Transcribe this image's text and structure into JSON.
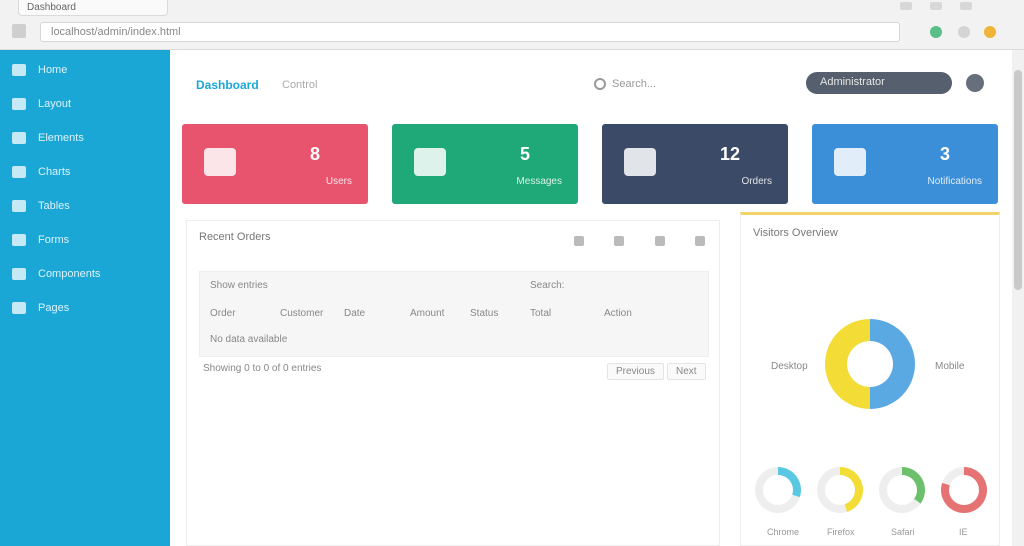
{
  "browser": {
    "tab_title": "Dashboard",
    "url": "localhost/admin/index.html"
  },
  "sidebar": {
    "items": [
      {
        "label": "Home",
        "icon": "home-icon"
      },
      {
        "label": "Layout",
        "icon": "layout-icon"
      },
      {
        "label": "Elements",
        "icon": "elements-icon"
      },
      {
        "label": "Charts",
        "icon": "chart-icon"
      },
      {
        "label": "Tables",
        "icon": "table-icon"
      },
      {
        "label": "Forms",
        "icon": "form-icon"
      },
      {
        "label": "Components",
        "icon": "components-icon"
      },
      {
        "label": "Pages",
        "icon": "pages-icon"
      }
    ]
  },
  "header": {
    "brand": "Dashboard",
    "brand_sub": "Control",
    "search_text": "Search...",
    "user_label": "Administrator"
  },
  "tiles": [
    {
      "value": "8",
      "label": "Users",
      "color": "#e8546d",
      "icon": "user-icon"
    },
    {
      "value": "5",
      "label": "Messages",
      "color": "#1fa878",
      "icon": "mail-icon"
    },
    {
      "value": "12",
      "label": "Orders",
      "color": "#3b4a66",
      "icon": "cart-icon"
    },
    {
      "value": "3",
      "label": "Notifications",
      "color": "#3a8fd8",
      "icon": "cloud-icon"
    }
  ],
  "main_panel": {
    "title": "Recent Orders",
    "filter_label": "Show entries",
    "filter_right": "Search:",
    "columns": [
      "Order",
      "Customer",
      "Date",
      "Amount",
      "Status",
      "Total",
      "Action"
    ],
    "extra_tag": "No data available",
    "result_text": "Showing 0 to 0 of 0 entries",
    "prev_label": "Previous",
    "next_label": "Next"
  },
  "right_panel": {
    "title": "Visitors Overview",
    "donut_left": "Desktop",
    "donut_right": "Mobile",
    "donut_colors": {
      "left": "#f2dc35",
      "right": "#5aa9e2"
    },
    "mini": [
      {
        "label": "Chrome",
        "color": "#5ac8e2",
        "value": 0.3
      },
      {
        "label": "Firefox",
        "color": "#f2dc35",
        "value": 0.45
      },
      {
        "label": "Safari",
        "color": "#6cc06c",
        "value": 0.35
      },
      {
        "label": "IE",
        "color": "#e57373",
        "value": 0.8
      }
    ]
  }
}
